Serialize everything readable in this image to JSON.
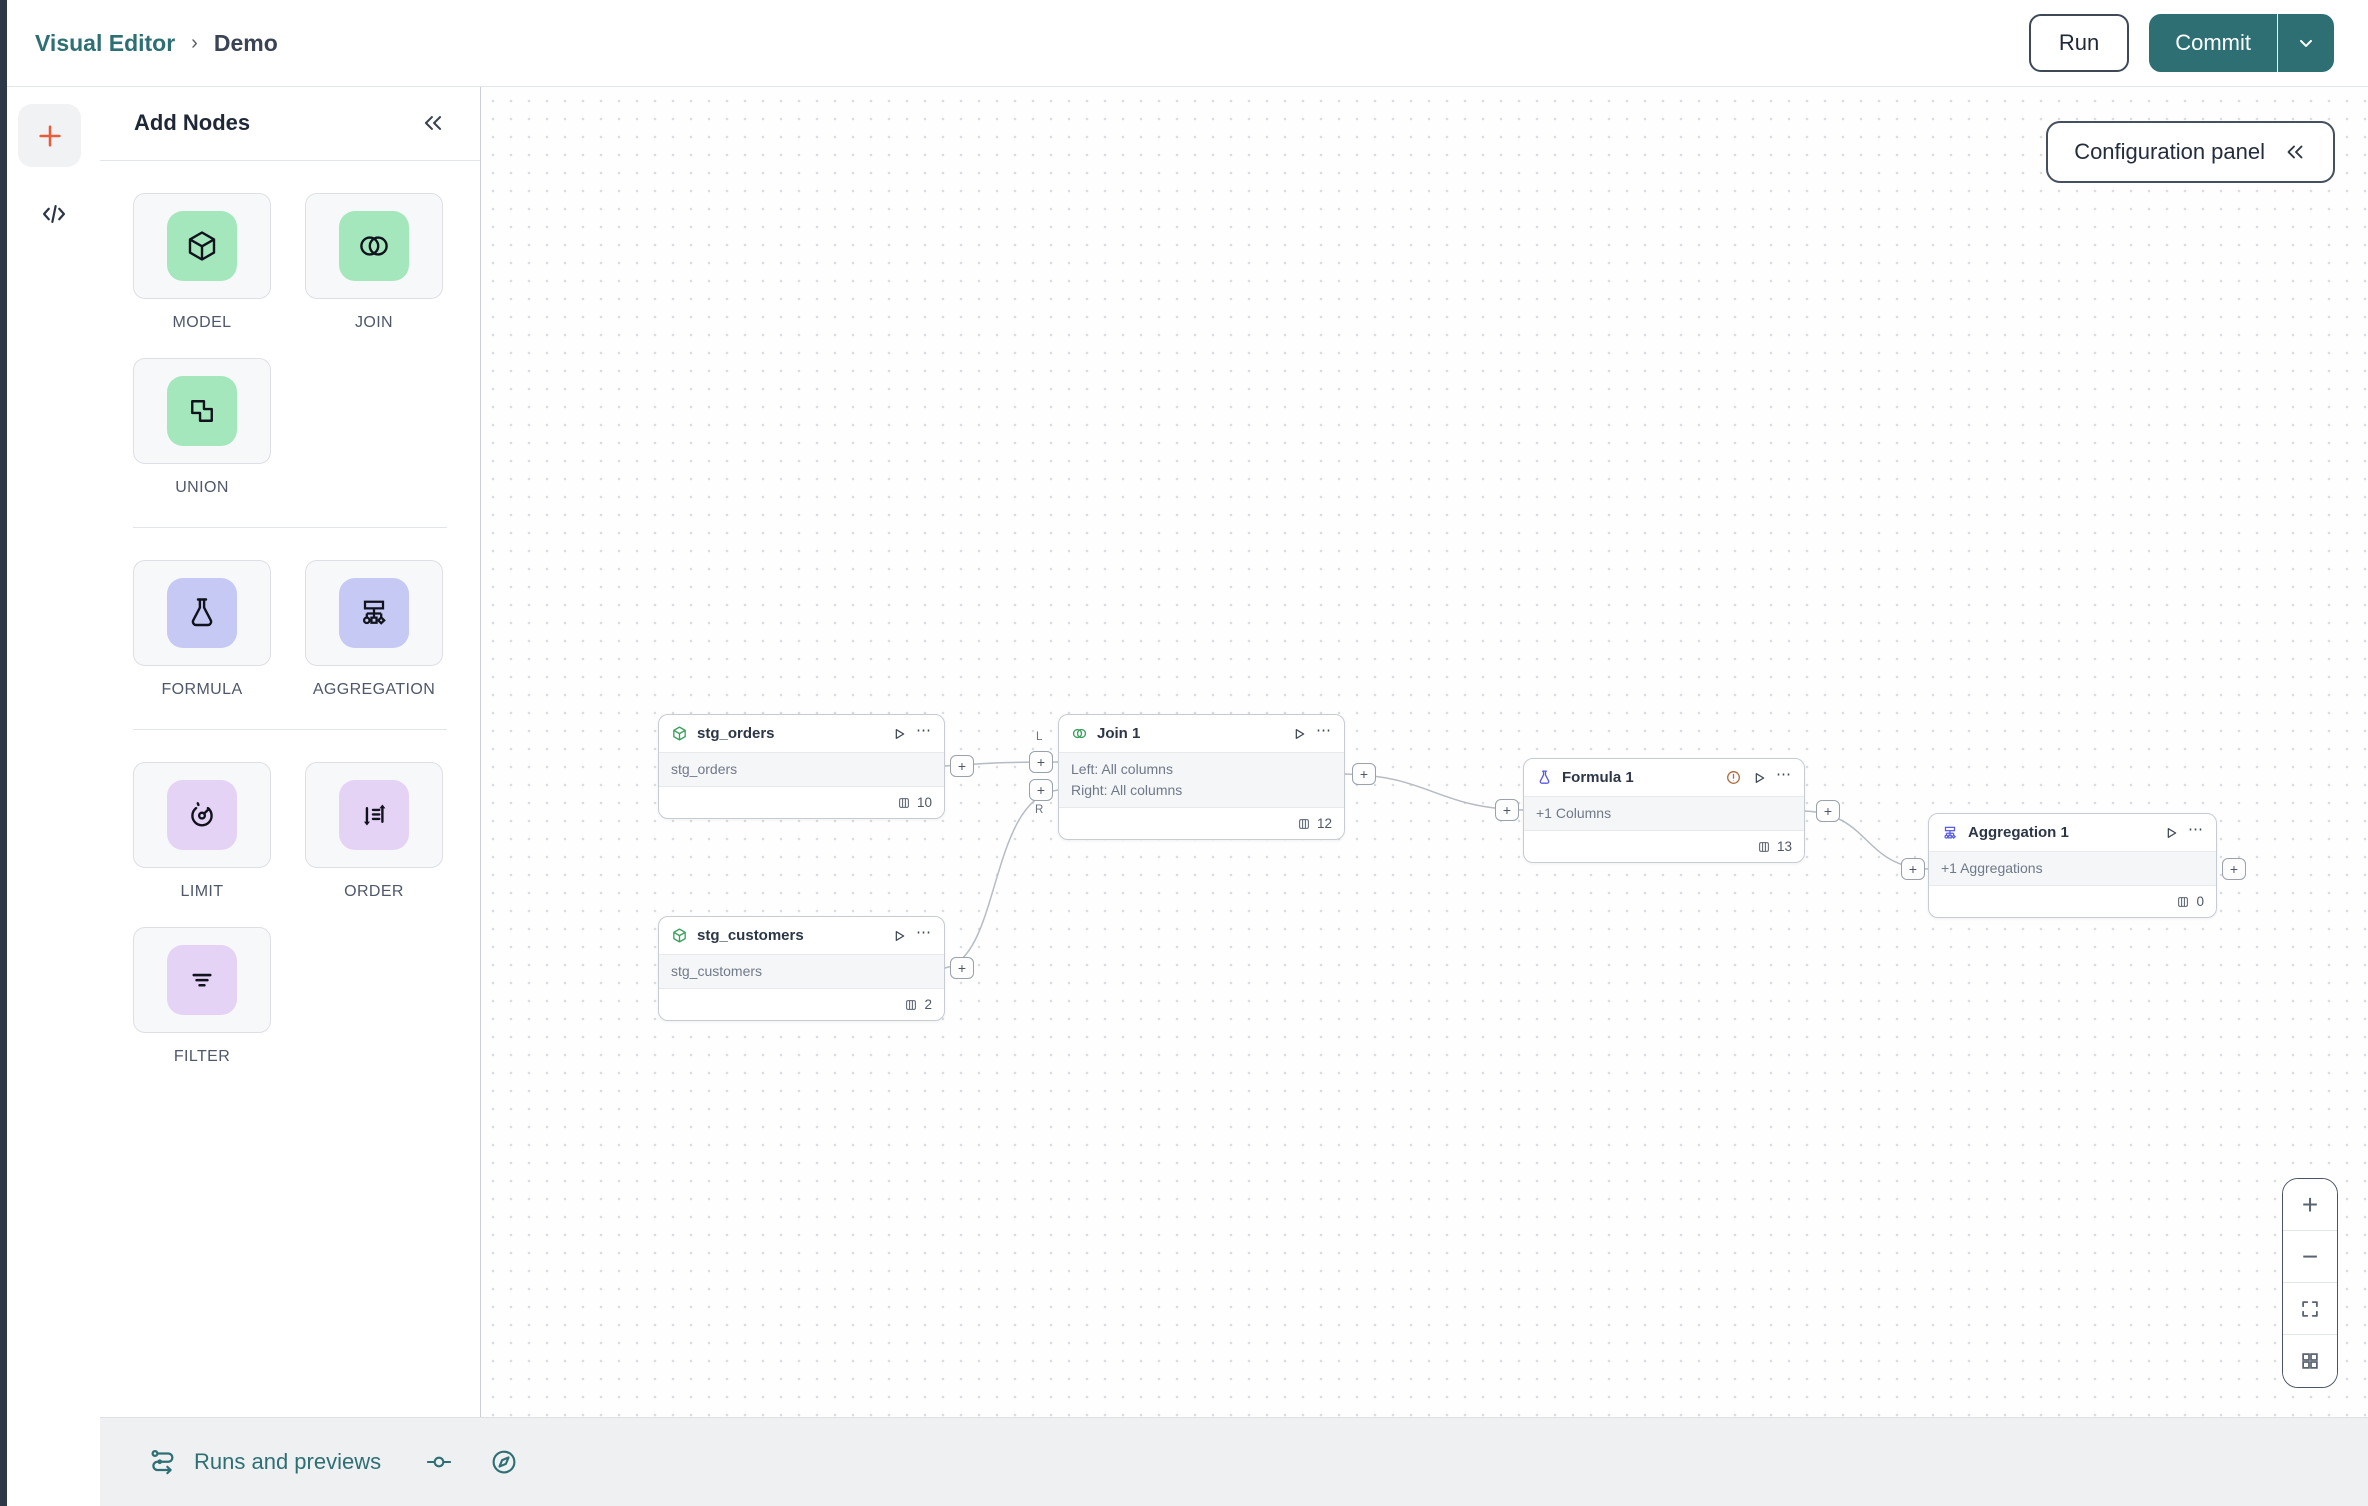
{
  "header": {
    "breadcrumb_root": "Visual Editor",
    "breadcrumb_separator": "›",
    "breadcrumb_current": "Demo",
    "run_label": "Run",
    "commit_label": "Commit"
  },
  "add_nodes": {
    "title": "Add Nodes",
    "groups": [
      {
        "tiles": [
          {
            "label": "MODEL"
          },
          {
            "label": "JOIN"
          },
          {
            "label": "UNION"
          }
        ]
      },
      {
        "tiles": [
          {
            "label": "FORMULA"
          },
          {
            "label": "AGGREGATION"
          }
        ]
      },
      {
        "tiles": [
          {
            "label": "LIMIT"
          },
          {
            "label": "ORDER"
          },
          {
            "label": "FILTER"
          }
        ]
      }
    ]
  },
  "canvas": {
    "config_panel_label": "Configuration panel",
    "join_port_left": "L",
    "join_port_right": "R",
    "nodes": [
      {
        "title": "stg_orders",
        "body_lines": [
          "stg_orders"
        ],
        "column_count": "10"
      },
      {
        "title": "Join 1",
        "body_lines": [
          "Left: All columns",
          "Right: All columns"
        ],
        "column_count": "12"
      },
      {
        "title": "Formula 1",
        "body_lines": [
          "+1 Columns"
        ],
        "column_count": "13"
      },
      {
        "title": "Aggregation 1",
        "body_lines": [
          "+1 Aggregations"
        ],
        "column_count": "0"
      },
      {
        "title": "stg_customers",
        "body_lines": [
          "stg_customers"
        ],
        "column_count": "2"
      }
    ]
  },
  "bottom_bar": {
    "runs_label": "Runs and previews"
  },
  "icons": {
    "plus": "+",
    "minus": "−",
    "ellipsis": "⋯"
  },
  "colors": {
    "accent_teal": "#2e6f74",
    "plus_orange": "#e85c3c",
    "node_green": "#3ca05f",
    "node_indigo": "#5a5ce0",
    "warning_orange": "#b06a3e",
    "tile_green": "#a5e7bd",
    "tile_indigo": "#c5c9f3",
    "tile_lilac": "#e5d3f6"
  }
}
